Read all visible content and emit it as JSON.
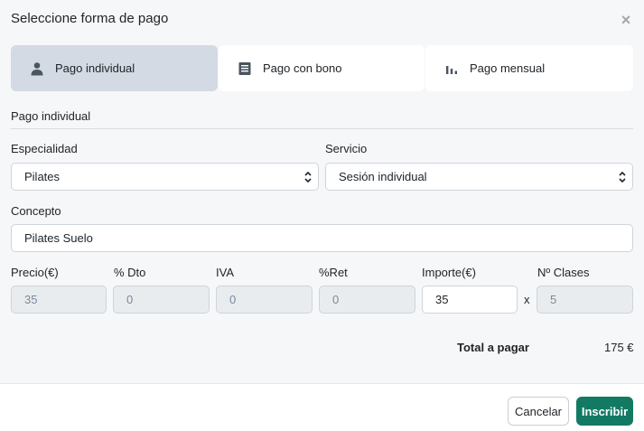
{
  "modal": {
    "title": "Seleccione forma de pago",
    "close_symbol": "×"
  },
  "tabs": [
    {
      "label": "Pago individual",
      "icon": "person-icon",
      "active": true
    },
    {
      "label": "Pago con bono",
      "icon": "voucher-icon",
      "active": false
    },
    {
      "label": "Pago mensual",
      "icon": "bar-chart-icon",
      "active": false
    }
  ],
  "section": {
    "title": "Pago individual"
  },
  "form": {
    "especialidad": {
      "label": "Especialidad",
      "value": "Pilates"
    },
    "servicio": {
      "label": "Servicio",
      "value": "Sesión individual"
    },
    "concepto": {
      "label": "Concepto",
      "value": "Pilates Suelo"
    },
    "precio": {
      "label": "Precio(€)",
      "value": "35"
    },
    "dto": {
      "label": "% Dto",
      "value": "0"
    },
    "iva": {
      "label": "IVA",
      "value": "0"
    },
    "ret": {
      "label": "%Ret",
      "value": "0"
    },
    "importe": {
      "label": "Importe(€)",
      "value": "35"
    },
    "multiply_symbol": "x",
    "clases": {
      "label": "Nº Clases",
      "value": "5"
    }
  },
  "total": {
    "label": "Total a pagar",
    "value": "175 €"
  },
  "footer": {
    "cancel_label": "Cancelar",
    "submit_label": "Inscribir"
  },
  "colors": {
    "primary": "#127a63",
    "active_tab": "#d4dae3",
    "background": "#f6f7f9"
  }
}
